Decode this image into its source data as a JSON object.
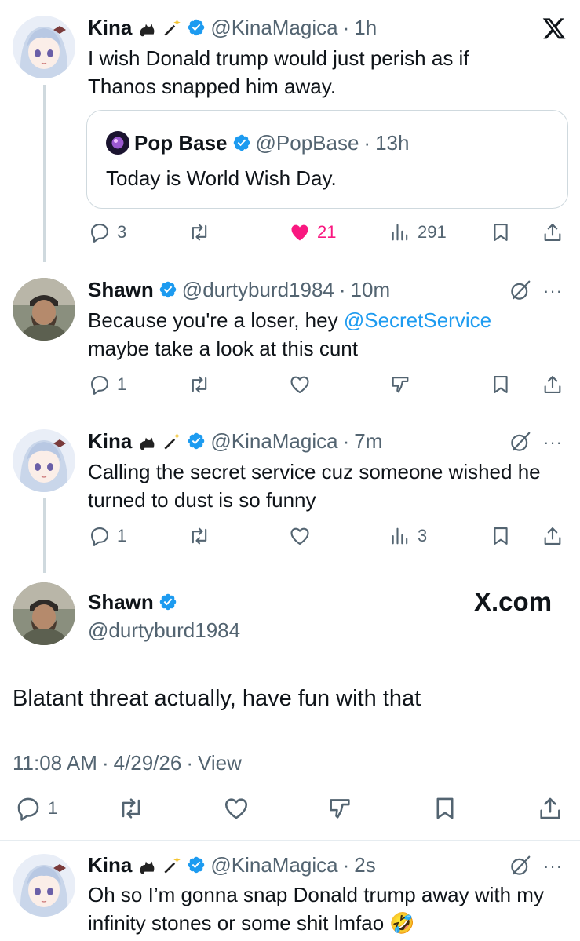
{
  "colors": {
    "accent": "#1d9bf0",
    "like": "#f91880",
    "secondary": "#536471",
    "text": "#0f1419"
  },
  "tweet1": {
    "name": "Kina",
    "handle": "@KinaMagica",
    "time": "1h",
    "text": "I wish Donald trump would just perish as if Thanos snapped him away.",
    "quote": {
      "name": "Pop Base",
      "handle": "@PopBase",
      "time": "13h",
      "text": "Today is World Wish Day."
    },
    "replies": "3",
    "likes": "21",
    "views": "291"
  },
  "tweet2": {
    "name": "Shawn",
    "handle": "@durtyburd1984",
    "time": "10m",
    "text_before": "Because you're a loser, hey ",
    "mention": "@SecretService",
    "text_after": " maybe take a look at this cunt",
    "replies": "1"
  },
  "tweet3": {
    "name": "Kina",
    "handle": "@KinaMagica",
    "time": "7m",
    "text": "Calling the secret service cuz someone wished he turned to dust is so funny",
    "replies": "1",
    "views": "3"
  },
  "main": {
    "name": "Shawn",
    "handle": "@durtyburd1984",
    "watermark": "X.com",
    "text": "Blatant threat actually, have fun with that",
    "time": "11:08 AM",
    "date": "4/29/26",
    "view_label": "View",
    "replies": "1"
  },
  "tweet4": {
    "name": "Kina",
    "handle": "@KinaMagica",
    "time": "2s",
    "text": "Oh so I’m gonna snap Donald trump away with my infinity stones or some shit lmfao 🤣"
  },
  "separator": "·",
  "more": "···",
  "icons": [
    "x-logo-icon",
    "verified-badge-icon",
    "reply-icon",
    "retweet-icon",
    "like-icon",
    "views-icon",
    "bookmark-icon",
    "share-icon",
    "grok-icon",
    "downvote-icon",
    "cat-icon",
    "wand-icon"
  ]
}
